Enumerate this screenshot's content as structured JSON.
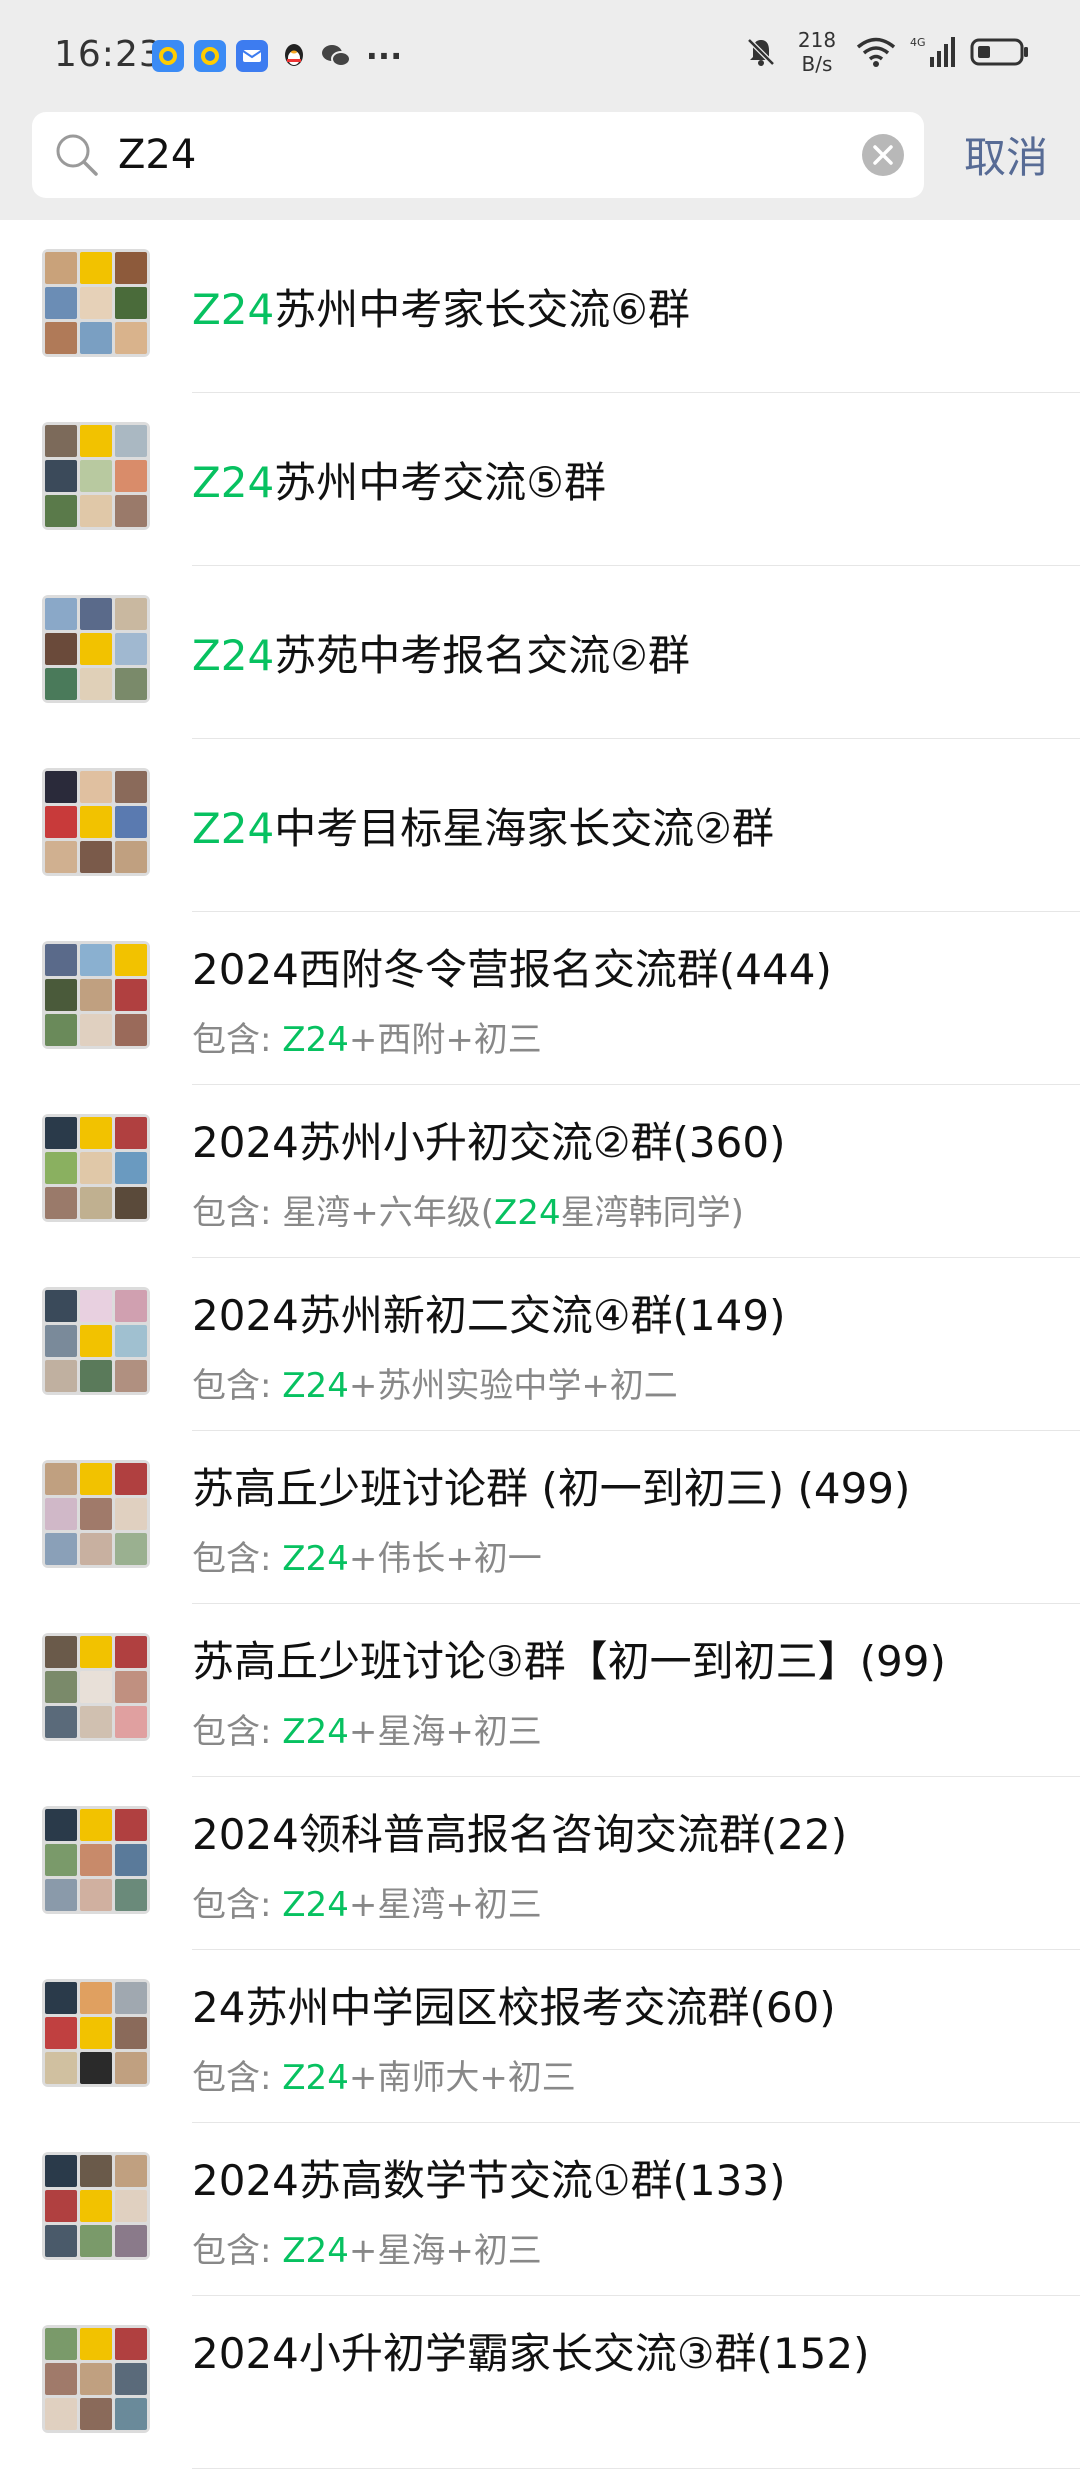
{
  "status_bar": {
    "time": "16:23",
    "notification_icons": [
      "browser-app-icon",
      "browser-app-icon-2",
      "mail-app-icon",
      "qq-penguin-icon",
      "wechat-icon"
    ],
    "more": "···",
    "net_speed_value": "218",
    "net_speed_unit": "B/s",
    "network": "4G",
    "icons": [
      "mute-bell-icon",
      "wifi-icon",
      "signal-icon",
      "battery-icon"
    ]
  },
  "search": {
    "query": "Z24",
    "cancel_label": "取消"
  },
  "colors": {
    "highlight": "#07c160",
    "cancel": "#576b95",
    "background_top": "#ededed"
  },
  "results": [
    {
      "title_hl": "Z24",
      "title_rest": "苏州中考家长交流⑥群"
    },
    {
      "title_hl": "Z24",
      "title_rest": "苏州中考交流⑤群"
    },
    {
      "title_hl": "Z24",
      "title_rest": "苏苑中考报名交流②群"
    },
    {
      "title_hl": "Z24",
      "title_rest": "中考目标星海家长交流②群"
    },
    {
      "title": "2024西附冬令营报名交流群(444)",
      "sub_pre": "包含: ",
      "sub_hl": "Z24",
      "sub_post": "+西附+初三"
    },
    {
      "title": "2024苏州小升初交流②群(360)",
      "sub_pre": "包含: 星湾+六年级(",
      "sub_hl": "Z24",
      "sub_post": "星湾韩同学)"
    },
    {
      "title": "2024苏州新初二交流④群(149)",
      "sub_pre": "包含: ",
      "sub_hl": "Z24",
      "sub_post": "+苏州实验中学+初二"
    },
    {
      "title": "苏高丘少班讨论群 (初一到初三) (499)",
      "sub_pre": "包含: ",
      "sub_hl": "Z24",
      "sub_post": "+伟长+初一"
    },
    {
      "title": "苏高丘少班讨论③群【初一到初三】(99)",
      "sub_pre": "包含: ",
      "sub_hl": "Z24",
      "sub_post": "+星海+初三"
    },
    {
      "title": "2024领科普高报名咨询交流群(22)",
      "sub_pre": "包含: ",
      "sub_hl": "Z24",
      "sub_post": "+星湾+初三"
    },
    {
      "title": "24苏州中学园区校报考交流群(60)",
      "sub_pre": "包含: ",
      "sub_hl": "Z24",
      "sub_post": "+南师大+初三"
    },
    {
      "title": "2024苏高数学节交流①群(133)",
      "sub_pre": "包含: ",
      "sub_hl": "Z24",
      "sub_post": "+星海+初三"
    },
    {
      "title": "2024小升初学霸家长交流③群(152)"
    }
  ]
}
